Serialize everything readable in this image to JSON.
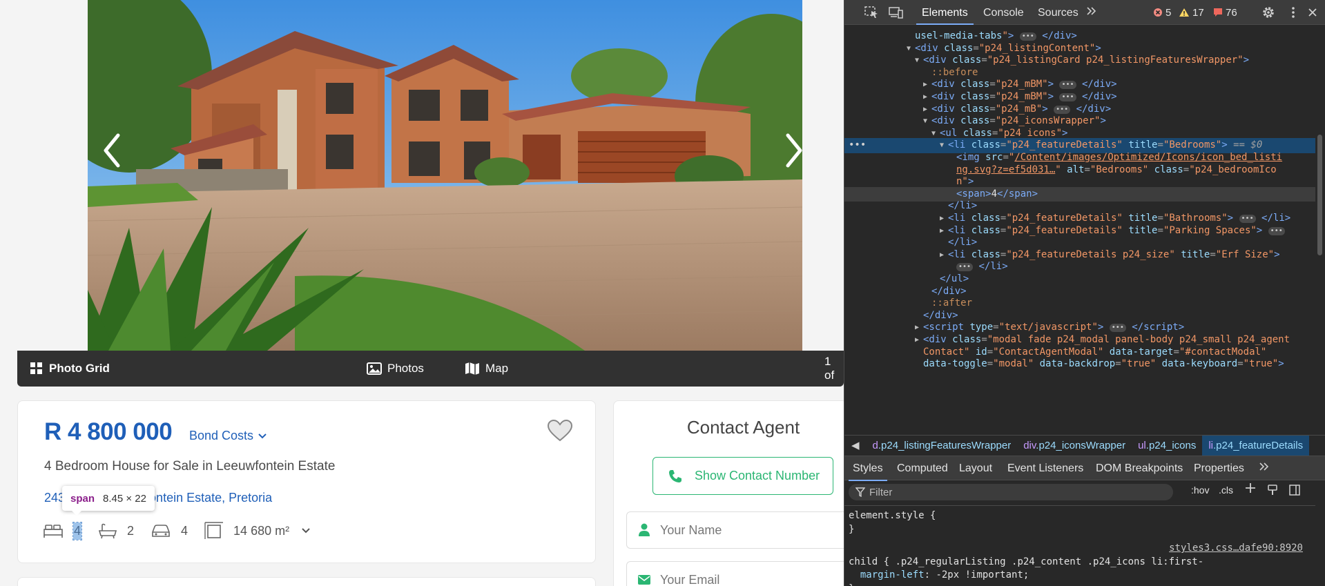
{
  "gallery": {
    "photo_grid_label": "Photo Grid",
    "photos_label": "Photos",
    "map_label": "Map",
    "counter": "1 of"
  },
  "listing": {
    "price": "R 4 800 000",
    "bond_costs_label": "Bond Costs",
    "title": "4 Bedroom House for Sale in Leeuwfontein Estate",
    "address_start": "243",
    "address_end": "fontein Estate, Pretoria",
    "features": {
      "bedrooms": "4",
      "bathrooms": "2",
      "parking": "4",
      "erf_size": "14 680 m²"
    }
  },
  "inspect_tooltip": {
    "tag": "span",
    "dimensions": "8.45 × 22"
  },
  "contact": {
    "title": "Contact Agent",
    "show_number_label": "Show Contact Number",
    "name_placeholder": "Your Name",
    "email_placeholder": "Your Email"
  },
  "devtools": {
    "tabs": [
      "Elements",
      "Console",
      "Sources"
    ],
    "errors": "5",
    "warnings": "17",
    "issues": "76",
    "dom_lines": [
      {
        "indent": 0,
        "html": "<span class='attr'>usel-media-tabs</span><span class='val'>\"</span><span class='tag'>&gt;</span> <span class='ell'>•••</span> <span class='tag'>&lt;/div&gt;</span>"
      },
      {
        "indent": 0,
        "tri": "▼",
        "html": "<span class='tag'>&lt;div</span> <span class='attr'>class</span><span class='eq'>=</span><span class='val'>\"p24_listingContent\"</span><span class='tag'>&gt;</span>"
      },
      {
        "indent": 1,
        "tri": "▼",
        "html": "<span class='tag'>&lt;div</span> <span class='attr'>class</span><span class='eq'>=</span><span class='val'>\"p24_listingCard p24_listingFeaturesWrapper\"</span><span class='tag'>&gt;</span>"
      },
      {
        "indent": 2,
        "html": "<span class='pseudo'>::before</span>"
      },
      {
        "indent": 2,
        "tri": "▶",
        "html": "<span class='tag'>&lt;div</span> <span class='attr'>class</span><span class='eq'>=</span><span class='val'>\"p24_mBM\"</span><span class='tag'>&gt;</span> <span class='ell'>•••</span> <span class='tag'>&lt;/div&gt;</span>"
      },
      {
        "indent": 2,
        "tri": "▶",
        "html": "<span class='tag'>&lt;div</span> <span class='attr'>class</span><span class='eq'>=</span><span class='val'>\"p24_mBM\"</span><span class='tag'>&gt;</span> <span class='ell'>•••</span> <span class='tag'>&lt;/div&gt;</span>"
      },
      {
        "indent": 2,
        "tri": "▶",
        "html": "<span class='tag'>&lt;div</span> <span class='attr'>class</span><span class='eq'>=</span><span class='val'>\"p24_mB\"</span><span class='tag'>&gt;</span> <span class='ell'>•••</span> <span class='tag'>&lt;/div&gt;</span>"
      },
      {
        "indent": 2,
        "tri": "▼",
        "html": "<span class='tag'>&lt;div</span> <span class='attr'>class</span><span class='eq'>=</span><span class='val'>\"p24_iconsWrapper\"</span><span class='tag'>&gt;</span>"
      },
      {
        "indent": 3,
        "tri": "▼",
        "html": "<span class='tag'>&lt;ul</span> <span class='attr'>class</span><span class='eq'>=</span><span class='val'>\"p24_icons\"</span><span class='tag'>&gt;</span>"
      },
      {
        "indent": 4,
        "tri": "▼",
        "sel": true,
        "html": "<span class='tag'>&lt;li</span> <span class='attr'>class</span><span class='eq'>=</span><span class='val'>\"p24_featureDetails\"</span> <span class='attr'>title</span><span class='eq'>=</span><span class='val'>\"Bedrooms\"</span><span class='tag'>&gt;</span> <span class='eq'>== <i>$0</i></span>"
      },
      {
        "indent": 5,
        "html": "<span class='tag'>&lt;img</span> <span class='attr'>src</span><span class='eq'>=</span><span class='val'>\"</span><span class='link'>/Content/images/Optimized/Icons/icon_bed_listi</span>"
      },
      {
        "indent": 5,
        "html": "<span class='link'>ng.svg?z=ef5d031…</span><span class='val'>\"</span> <span class='attr'>alt</span><span class='eq'>=</span><span class='val'>\"Bedrooms\"</span> <span class='attr'>class</span><span class='eq'>=</span><span class='val'>\"p24_bedroomIco</span>"
      },
      {
        "indent": 5,
        "html": "<span class='val'>n\"</span><span class='tag'>&gt;</span>"
      },
      {
        "indent": 5,
        "hov": true,
        "html": "<span class='tag'>&lt;span&gt;</span><span class='txt'>4</span><span class='tag'>&lt;/span&gt;</span>"
      },
      {
        "indent": 4,
        "html": "<span class='tag'>&lt;/li&gt;</span>"
      },
      {
        "indent": 4,
        "tri": "▶",
        "html": "<span class='tag'>&lt;li</span> <span class='attr'>class</span><span class='eq'>=</span><span class='val'>\"p24_featureDetails\"</span> <span class='attr'>title</span><span class='eq'>=</span><span class='val'>\"Bathrooms\"</span><span class='tag'>&gt;</span> <span class='ell'>•••</span> <span class='tag'>&lt;/li&gt;</span>"
      },
      {
        "indent": 4,
        "tri": "▶",
        "html": "<span class='tag'>&lt;li</span> <span class='attr'>class</span><span class='eq'>=</span><span class='val'>\"p24_featureDetails\"</span> <span class='attr'>title</span><span class='eq'>=</span><span class='val'>\"Parking Spaces\"</span><span class='tag'>&gt;</span> <span class='ell'>•••</span>"
      },
      {
        "indent": 4,
        "html": "<span class='tag'>&lt;/li&gt;</span>"
      },
      {
        "indent": 4,
        "tri": "▶",
        "html": "<span class='tag'>&lt;li</span> <span class='attr'>class</span><span class='eq'>=</span><span class='val'>\"p24_featureDetails p24_size\"</span> <span class='attr'>title</span><span class='eq'>=</span><span class='val'>\"Erf Size\"</span><span class='tag'>&gt;</span>"
      },
      {
        "indent": 5,
        "html": "<span class='ell'>•••</span> <span class='tag'>&lt;/li&gt;</span>"
      },
      {
        "indent": 3,
        "html": "<span class='tag'>&lt;/ul&gt;</span>"
      },
      {
        "indent": 2,
        "html": "<span class='tag'>&lt;/div&gt;</span>"
      },
      {
        "indent": 2,
        "html": "<span class='pseudo'>::after</span>"
      },
      {
        "indent": 1,
        "html": "<span class='tag'>&lt;/div&gt;</span>"
      },
      {
        "indent": 1,
        "tri": "▶",
        "html": "<span class='tag'>&lt;script</span> <span class='attr'>type</span><span class='eq'>=</span><span class='val'>\"text/javascript\"</span><span class='tag'>&gt;</span> <span class='ell'>•••</span> <span class='tag'>&lt;/script&gt;</span>"
      },
      {
        "indent": 1,
        "tri": "▶",
        "html": "<span class='tag'>&lt;div</span> <span class='attr'>class</span><span class='eq'>=</span><span class='val'>\"modal fade p24_modal panel-body p24_small p24_agent</span>"
      },
      {
        "indent": 1,
        "html": "<span class='val'>Contact\"</span> <span class='attr'>id</span><span class='eq'>=</span><span class='val'>\"ContactAgentModal\"</span> <span class='attr'>data-target</span><span class='eq'>=</span><span class='val'>\"#contactModal\"</span>"
      },
      {
        "indent": 1,
        "html": "<span class='attr'>data-toggle</span><span class='eq'>=</span><span class='val'>\"modal\"</span> <span class='attr'>data-backdrop</span><span class='eq'>=</span><span class='val'>\"true\"</span> <span class='attr'>data-keyboard</span><span class='eq'>=</span><span class='val'>\"true\"</span><span class='tag'>&gt;</span>"
      }
    ],
    "breadcrumbs": [
      {
        "tag": "d",
        "cls": ".p24_listingFeaturesWrapper"
      },
      {
        "tag": "div",
        "cls": ".p24_iconsWrapper"
      },
      {
        "tag": "ul",
        "cls": ".p24_icons"
      },
      {
        "tag": "li",
        "cls": ".p24_featureDetails"
      }
    ],
    "sub_tabs": [
      "Styles",
      "Computed",
      "Layout",
      "Event Listeners",
      "DOM Breakpoints",
      "Properties"
    ],
    "filter_placeholder": "Filter",
    "filter_hov": ":hov",
    "filter_cls": ".cls",
    "styles": {
      "element_style": "element.style {",
      "close_brace": "}",
      "rule_selector_1": ".p24_regularListing .p24_content .p24_icons li:first-",
      "rule_selector_2": "child {",
      "source": "styles3.css…dafe90:8920",
      "property": "margin-left",
      "value": "-2px !important;"
    }
  },
  "colors": {
    "brand_blue": "#1f5fb8",
    "contact_green": "#2bb673",
    "devtools_bg": "#282828",
    "selected_row": "#1a4870"
  }
}
